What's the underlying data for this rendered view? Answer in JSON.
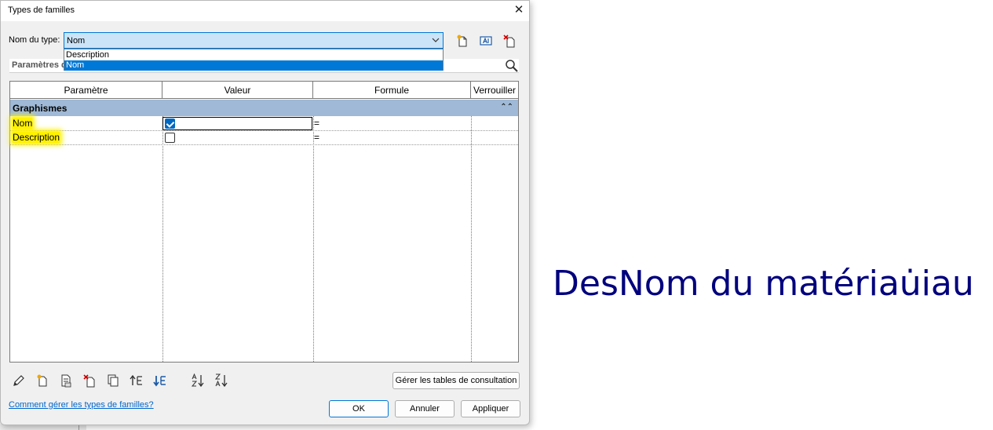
{
  "window": {
    "title": "Types de familles",
    "close_glyph": "✕"
  },
  "type_selector": {
    "label": "Nom du type:",
    "selected_value": "Nom",
    "options": [
      {
        "label": "Description",
        "selected": false
      },
      {
        "label": "Nom",
        "selected": true
      }
    ]
  },
  "params_search": {
    "label": "Paramètres de"
  },
  "grid": {
    "columns": [
      "Paramètre",
      "Valeur",
      "Formule",
      "Verrouiller"
    ],
    "group": {
      "label": "Graphismes",
      "expander_glyph": "⌃⌃"
    },
    "rows": [
      {
        "parameter": "Nom",
        "checked": true,
        "formula": "="
      },
      {
        "parameter": "Description",
        "checked": false,
        "formula": "="
      }
    ]
  },
  "buttons": {
    "manage_lookup": "Gérer les tables de consultation",
    "ok": "OK",
    "cancel": "Annuler",
    "apply": "Appliquer"
  },
  "help_link": "Comment gérer les types de familles?",
  "overlay_text": "DesNom du matériau̇iau",
  "colors": {
    "accent": "#0078d7",
    "group_header": "#9fb9d6",
    "highlight": "#fff200",
    "overlay_text": "#00007d"
  },
  "icons": [
    "new-type-icon",
    "rename-type-icon",
    "delete-type-icon",
    "search-icon",
    "pencil-icon",
    "new-parameter-icon",
    "parameter-properties-icon",
    "delete-parameter-icon",
    "copy-icon",
    "move-up-icon",
    "move-down-icon",
    "sort-ascending-icon",
    "sort-descending-icon"
  ]
}
